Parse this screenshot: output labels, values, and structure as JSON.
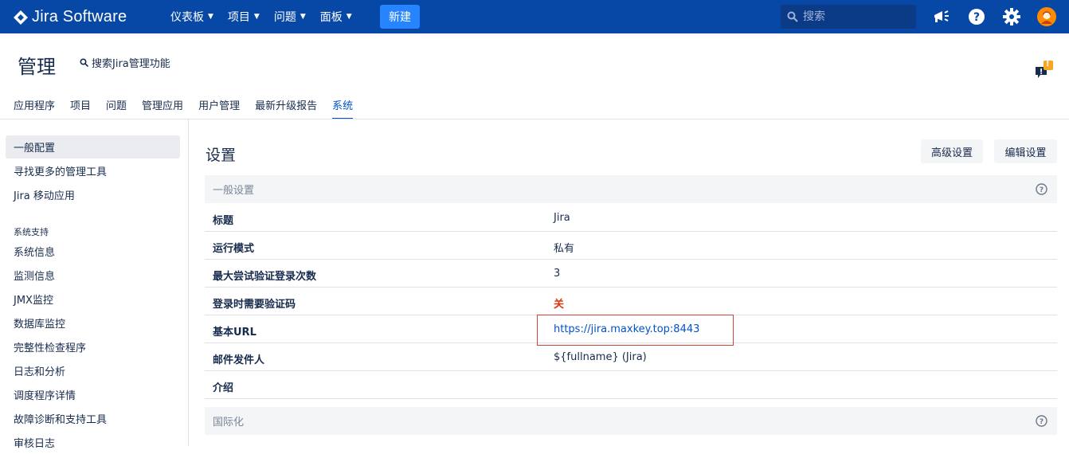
{
  "topnav": {
    "logo_text": "Jira Software",
    "menu": [
      "仪表板",
      "项目",
      "问题",
      "面板"
    ],
    "create_label": "新建",
    "search_placeholder": "搜索",
    "colors": {
      "bar": "#0747a6",
      "create": "#2684ff"
    },
    "icons": [
      "megaphone-icon",
      "help-icon",
      "gear-icon",
      "avatar"
    ]
  },
  "admin": {
    "title": "管理",
    "search_label": "搜索Jira管理功能",
    "feedback_count": "!"
  },
  "tabs": [
    {
      "label": "应用程序",
      "active": false
    },
    {
      "label": "项目",
      "active": false
    },
    {
      "label": "问题",
      "active": false
    },
    {
      "label": "管理应用",
      "active": false
    },
    {
      "label": "用户管理",
      "active": false
    },
    {
      "label": "最新升级报告",
      "active": false
    },
    {
      "label": "系统",
      "active": true
    }
  ],
  "sidebar": {
    "top_items": [
      "一般配置",
      "寻找更多的管理工具",
      "Jira 移动应用"
    ],
    "section_heading": "系统支持",
    "support_items": [
      "系统信息",
      "监测信息",
      "JMX监控",
      "数据库监控",
      "完整性检查程序",
      "日志和分析",
      "调度程序详情",
      "故障诊断和支持工具",
      "审核日志"
    ]
  },
  "main": {
    "heading": "设置",
    "advanced_button": "高级设置",
    "edit_button": "编辑设置",
    "general_section": "一般设置",
    "rows": [
      {
        "key": "标题",
        "value": "Jira"
      },
      {
        "key": "运行模式",
        "value": "私有"
      },
      {
        "key": "最大尝试验证登录次数",
        "value": "3"
      },
      {
        "key": "登录时需要验证码",
        "value": "关"
      },
      {
        "key": "基本URL",
        "value": "https://jira.maxkey.top:8443"
      },
      {
        "key": "邮件发件人",
        "value": "${fullname} (Jira)"
      },
      {
        "key": "介绍",
        "value": ""
      }
    ],
    "intl_section": "国际化"
  }
}
